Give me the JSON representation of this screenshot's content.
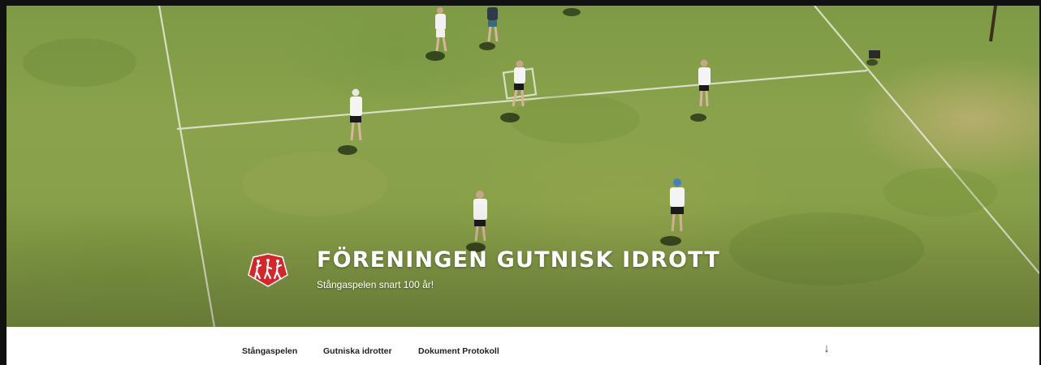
{
  "header": {
    "site_title": "FÖRENINGEN GUTNISK IDROTT",
    "tagline": "Stångaspelen snart 100 år!",
    "logo_icon": "club-logo-three-figures-icon"
  },
  "nav": {
    "items": [
      {
        "label": "Stångaspelen"
      },
      {
        "label": "Gutniska idrotter"
      },
      {
        "label": "Dokument Protokoll"
      }
    ],
    "scroll_icon": "arrow-down-icon",
    "scroll_glyph": "↓"
  },
  "colors": {
    "grass": "#86a04a",
    "logo_red": "#d6262a",
    "title_text": "#ffffff",
    "nav_text": "#222222"
  }
}
